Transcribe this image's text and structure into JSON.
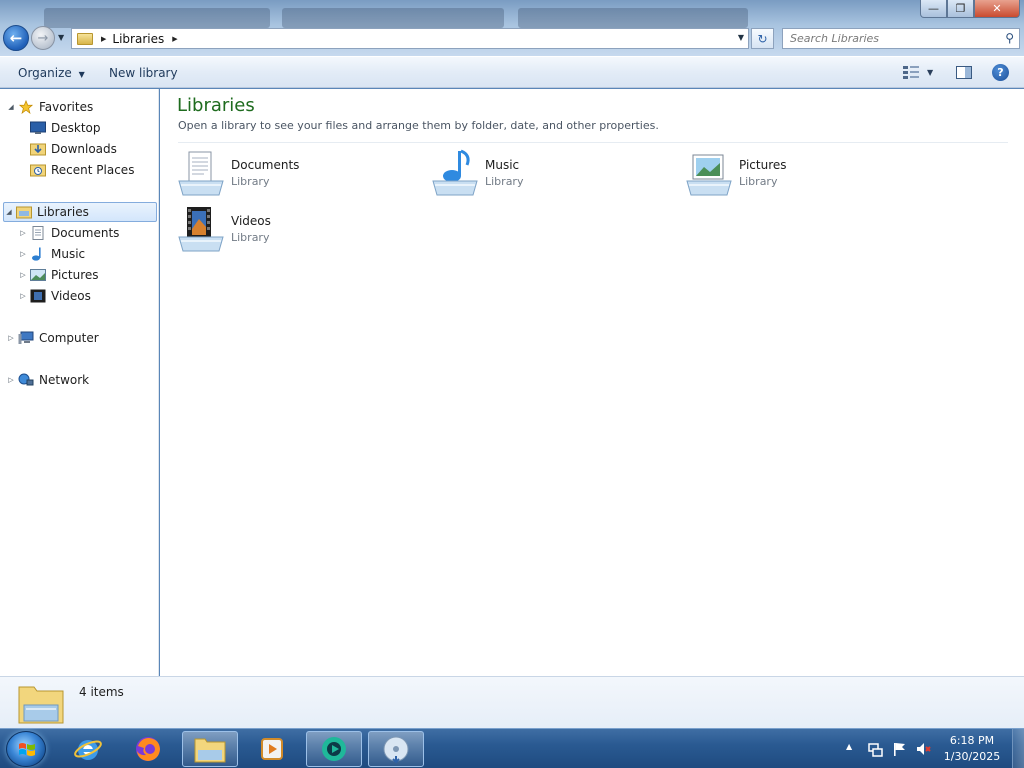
{
  "window": {
    "address_crumb": "Libraries",
    "search_placeholder": "Search Libraries"
  },
  "toolbar": {
    "organize_label": "Organize",
    "new_library_label": "New library"
  },
  "nav": {
    "favorites": {
      "label": "Favorites",
      "items": [
        "Desktop",
        "Downloads",
        "Recent Places"
      ]
    },
    "libraries": {
      "label": "Libraries",
      "items": [
        "Documents",
        "Music",
        "Pictures",
        "Videos"
      ]
    },
    "computer_label": "Computer",
    "network_label": "Network"
  },
  "content": {
    "title": "Libraries",
    "subtitle": "Open a library to see your files and arrange them by folder, date, and other properties.",
    "items": [
      {
        "name": "Documents",
        "type": "Library",
        "icon": "documents-library-icon"
      },
      {
        "name": "Music",
        "type": "Library",
        "icon": "music-library-icon"
      },
      {
        "name": "Pictures",
        "type": "Library",
        "icon": "pictures-library-icon"
      },
      {
        "name": "Videos",
        "type": "Library",
        "icon": "videos-library-icon"
      }
    ]
  },
  "details": {
    "item_count": "4 items"
  },
  "taskbar": {
    "pinned": [
      "internet-explorer-icon",
      "firefox-icon",
      "file-explorer-icon",
      "media-player-icon",
      "app-icon",
      "disc-icon"
    ],
    "time": "6:18 PM",
    "date": "1/30/2025"
  }
}
